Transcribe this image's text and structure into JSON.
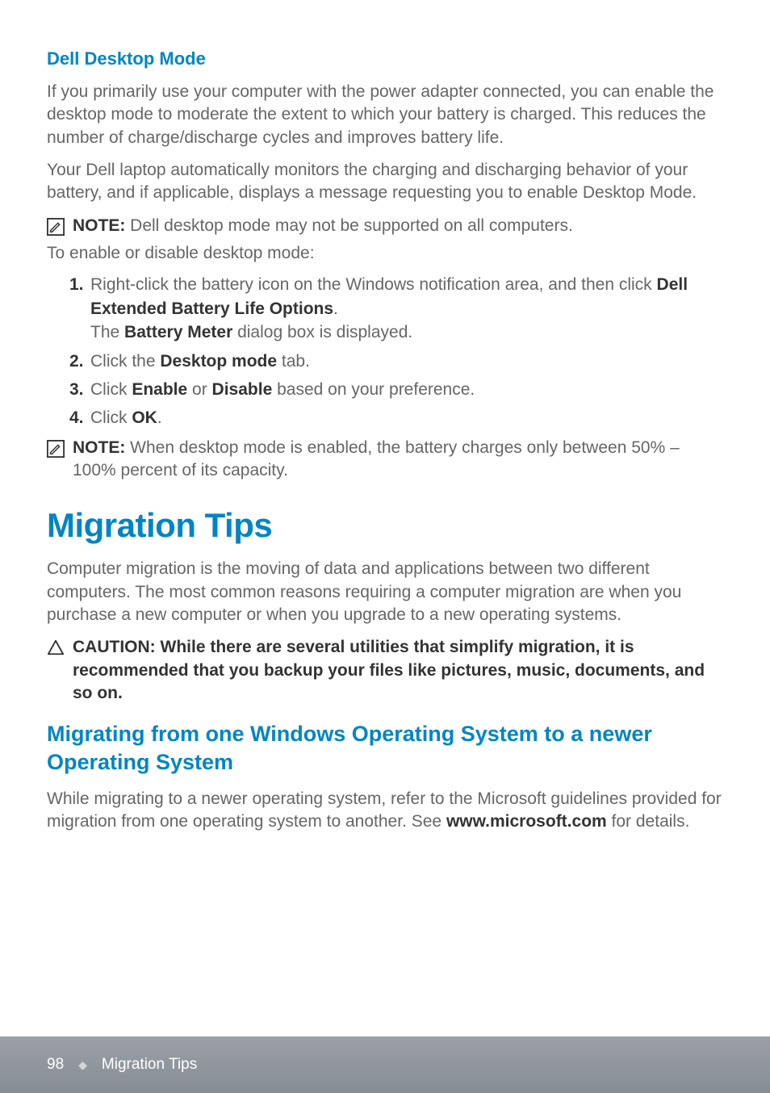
{
  "section1": {
    "heading": "Dell Desktop Mode",
    "p1": "If you primarily use your computer with the power adapter connected, you can enable the desktop mode to moderate the extent to which your battery is charged. This reduces the number of charge/discharge cycles and improves battery life.",
    "p2": "Your Dell laptop automatically monitors the charging and discharging behavior of your battery, and if applicable, displays a message requesting you to enable Desktop Mode.",
    "note1_label": "NOTE:",
    "note1_text": " Dell desktop mode may not be supported on all computers.",
    "intro": "To enable or disable desktop mode:",
    "steps": [
      {
        "num": "1.",
        "pre": "Right-click the battery icon on the Windows notification area, and then click ",
        "bold1": "Dell Extended Battery Life Options",
        "mid": ".\nThe ",
        "bold2": "Battery Meter",
        "post": " dialog box is displayed."
      },
      {
        "num": "2.",
        "pre": "Click the ",
        "bold1": "Desktop mode",
        "post": " tab."
      },
      {
        "num": "3.",
        "pre": "Click ",
        "bold1": "Enable",
        "mid": " or ",
        "bold2": "Disable",
        "post": " based on your preference."
      },
      {
        "num": "4.",
        "pre": "Click ",
        "bold1": "OK",
        "post": "."
      }
    ],
    "note2_label": "NOTE:",
    "note2_text": " When desktop mode is enabled, the battery charges only between 50% – 100% percent of its capacity."
  },
  "section2": {
    "heading": "Migration Tips",
    "p1": "Computer migration is the moving of data and applications between two different computers. The most common reasons requiring a computer migration are when you purchase a new computer or when you upgrade to a new operating systems.",
    "caution_label": "CAUTION: ",
    "caution_text": "While there are several utilities that simplify migration, it is recommended that you backup your files like pictures, music, documents, and so on.",
    "subheading": "Migrating from one Windows Operating System to a newer Operating System",
    "p2_pre": "While migrating to a newer operating system, refer to the Microsoft guidelines provided for migration from one operating system to another. See ",
    "p2_bold": "www.microsoft.com",
    "p2_post": " for details."
  },
  "footer": {
    "page": "98",
    "diamond": "◆",
    "title": "Migration Tips"
  }
}
